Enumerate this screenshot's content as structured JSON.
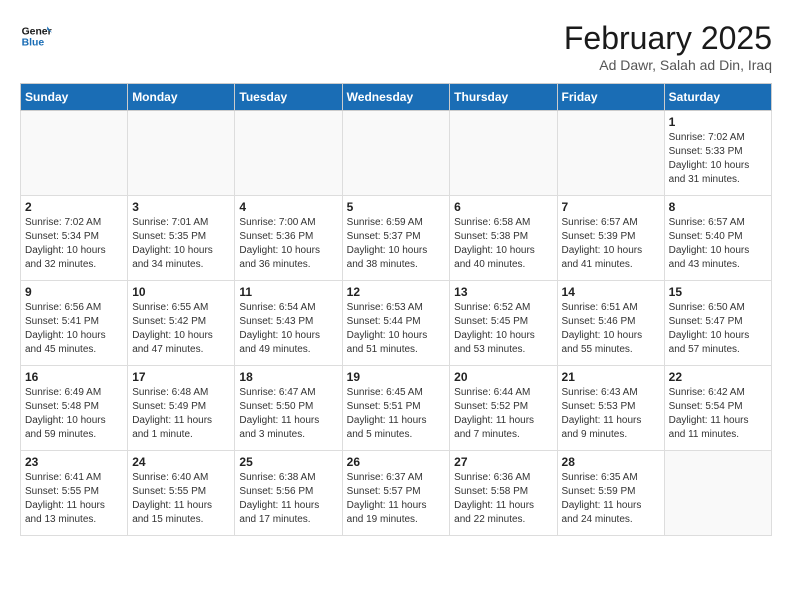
{
  "header": {
    "logo_line1": "General",
    "logo_line2": "Blue",
    "month_title": "February 2025",
    "subtitle": "Ad Dawr, Salah ad Din, Iraq"
  },
  "weekdays": [
    "Sunday",
    "Monday",
    "Tuesday",
    "Wednesday",
    "Thursday",
    "Friday",
    "Saturday"
  ],
  "weeks": [
    [
      {
        "day": "",
        "info": ""
      },
      {
        "day": "",
        "info": ""
      },
      {
        "day": "",
        "info": ""
      },
      {
        "day": "",
        "info": ""
      },
      {
        "day": "",
        "info": ""
      },
      {
        "day": "",
        "info": ""
      },
      {
        "day": "1",
        "info": "Sunrise: 7:02 AM\nSunset: 5:33 PM\nDaylight: 10 hours and 31 minutes."
      }
    ],
    [
      {
        "day": "2",
        "info": "Sunrise: 7:02 AM\nSunset: 5:34 PM\nDaylight: 10 hours and 32 minutes."
      },
      {
        "day": "3",
        "info": "Sunrise: 7:01 AM\nSunset: 5:35 PM\nDaylight: 10 hours and 34 minutes."
      },
      {
        "day": "4",
        "info": "Sunrise: 7:00 AM\nSunset: 5:36 PM\nDaylight: 10 hours and 36 minutes."
      },
      {
        "day": "5",
        "info": "Sunrise: 6:59 AM\nSunset: 5:37 PM\nDaylight: 10 hours and 38 minutes."
      },
      {
        "day": "6",
        "info": "Sunrise: 6:58 AM\nSunset: 5:38 PM\nDaylight: 10 hours and 40 minutes."
      },
      {
        "day": "7",
        "info": "Sunrise: 6:57 AM\nSunset: 5:39 PM\nDaylight: 10 hours and 41 minutes."
      },
      {
        "day": "8",
        "info": "Sunrise: 6:57 AM\nSunset: 5:40 PM\nDaylight: 10 hours and 43 minutes."
      }
    ],
    [
      {
        "day": "9",
        "info": "Sunrise: 6:56 AM\nSunset: 5:41 PM\nDaylight: 10 hours and 45 minutes."
      },
      {
        "day": "10",
        "info": "Sunrise: 6:55 AM\nSunset: 5:42 PM\nDaylight: 10 hours and 47 minutes."
      },
      {
        "day": "11",
        "info": "Sunrise: 6:54 AM\nSunset: 5:43 PM\nDaylight: 10 hours and 49 minutes."
      },
      {
        "day": "12",
        "info": "Sunrise: 6:53 AM\nSunset: 5:44 PM\nDaylight: 10 hours and 51 minutes."
      },
      {
        "day": "13",
        "info": "Sunrise: 6:52 AM\nSunset: 5:45 PM\nDaylight: 10 hours and 53 minutes."
      },
      {
        "day": "14",
        "info": "Sunrise: 6:51 AM\nSunset: 5:46 PM\nDaylight: 10 hours and 55 minutes."
      },
      {
        "day": "15",
        "info": "Sunrise: 6:50 AM\nSunset: 5:47 PM\nDaylight: 10 hours and 57 minutes."
      }
    ],
    [
      {
        "day": "16",
        "info": "Sunrise: 6:49 AM\nSunset: 5:48 PM\nDaylight: 10 hours and 59 minutes."
      },
      {
        "day": "17",
        "info": "Sunrise: 6:48 AM\nSunset: 5:49 PM\nDaylight: 11 hours and 1 minute."
      },
      {
        "day": "18",
        "info": "Sunrise: 6:47 AM\nSunset: 5:50 PM\nDaylight: 11 hours and 3 minutes."
      },
      {
        "day": "19",
        "info": "Sunrise: 6:45 AM\nSunset: 5:51 PM\nDaylight: 11 hours and 5 minutes."
      },
      {
        "day": "20",
        "info": "Sunrise: 6:44 AM\nSunset: 5:52 PM\nDaylight: 11 hours and 7 minutes."
      },
      {
        "day": "21",
        "info": "Sunrise: 6:43 AM\nSunset: 5:53 PM\nDaylight: 11 hours and 9 minutes."
      },
      {
        "day": "22",
        "info": "Sunrise: 6:42 AM\nSunset: 5:54 PM\nDaylight: 11 hours and 11 minutes."
      }
    ],
    [
      {
        "day": "23",
        "info": "Sunrise: 6:41 AM\nSunset: 5:55 PM\nDaylight: 11 hours and 13 minutes."
      },
      {
        "day": "24",
        "info": "Sunrise: 6:40 AM\nSunset: 5:55 PM\nDaylight: 11 hours and 15 minutes."
      },
      {
        "day": "25",
        "info": "Sunrise: 6:38 AM\nSunset: 5:56 PM\nDaylight: 11 hours and 17 minutes."
      },
      {
        "day": "26",
        "info": "Sunrise: 6:37 AM\nSunset: 5:57 PM\nDaylight: 11 hours and 19 minutes."
      },
      {
        "day": "27",
        "info": "Sunrise: 6:36 AM\nSunset: 5:58 PM\nDaylight: 11 hours and 22 minutes."
      },
      {
        "day": "28",
        "info": "Sunrise: 6:35 AM\nSunset: 5:59 PM\nDaylight: 11 hours and 24 minutes."
      },
      {
        "day": "",
        "info": ""
      }
    ]
  ]
}
